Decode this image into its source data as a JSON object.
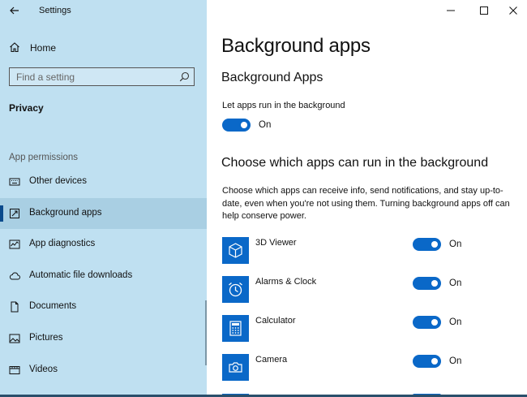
{
  "window": {
    "title": "Settings",
    "controls": [
      "minimize-icon",
      "maximize-icon",
      "close-icon"
    ]
  },
  "sidebar": {
    "home_label": "Home",
    "search_placeholder": "Find a setting",
    "section_title": "Privacy",
    "group_title": "App permissions",
    "items": [
      {
        "label": "Other devices",
        "icon": "keyboard-icon",
        "active": false
      },
      {
        "label": "Background apps",
        "icon": "background-apps-icon",
        "active": true
      },
      {
        "label": "App diagnostics",
        "icon": "diagnostics-icon",
        "active": false
      },
      {
        "label": "Automatic file downloads",
        "icon": "cloud-icon",
        "active": false
      },
      {
        "label": "Documents",
        "icon": "document-icon",
        "active": false
      },
      {
        "label": "Pictures",
        "icon": "picture-icon",
        "active": false
      },
      {
        "label": "Videos",
        "icon": "video-icon",
        "active": false
      }
    ]
  },
  "main": {
    "page_title": "Background apps",
    "sub_title": "Background Apps",
    "let_apps_label": "Let apps run in the background",
    "let_apps_state": "On",
    "choose_title": "Choose which apps can run in the background",
    "choose_desc": "Choose which apps can receive info, send notifications, and stay up-to-date, even when you're not using them. Turning background apps off can help conserve power.",
    "apps": [
      {
        "name": "3D Viewer",
        "state": "On",
        "icon": "cube-icon"
      },
      {
        "name": "Alarms & Clock",
        "state": "On",
        "icon": "alarm-clock-icon"
      },
      {
        "name": "Calculator",
        "state": "On",
        "icon": "calculator-icon"
      },
      {
        "name": "Camera",
        "state": "On",
        "icon": "camera-icon"
      }
    ]
  },
  "colors": {
    "sidebar_bg": "#bfe0f1",
    "accent": "#0a68c8",
    "active_item_bg": "#a9cfe3"
  }
}
